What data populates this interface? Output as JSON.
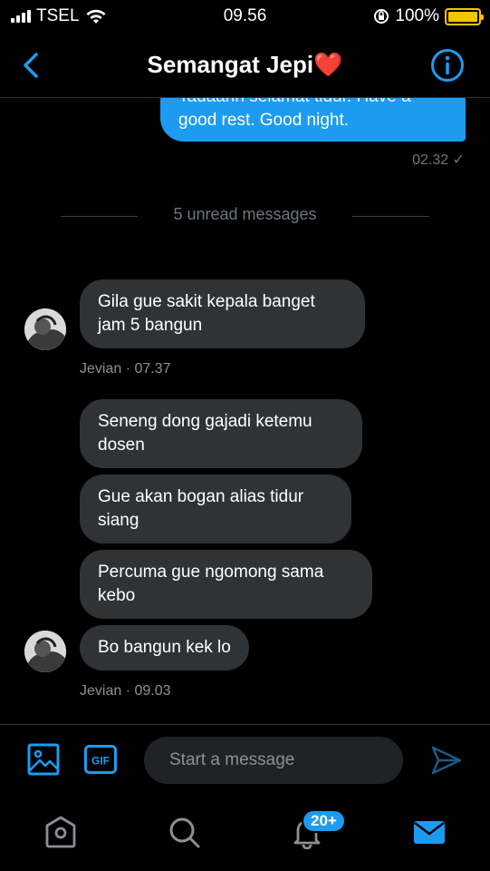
{
  "status_bar": {
    "carrier": "TSEL",
    "time": "09.56",
    "battery": "100%"
  },
  "header": {
    "title": "Semangat Jepi❤️"
  },
  "outgoing": {
    "text_line1": "Tadaahh selamat tidur. Have a",
    "text_line2": "good rest. Good night.",
    "time": "02.32 ✓"
  },
  "divider": {
    "label": "5 unread messages"
  },
  "messages": [
    {
      "text": "Gila gue sakit kepala banget jam 5 bangun"
    },
    {
      "text": "Seneng dong gajadi ketemu dosen"
    },
    {
      "text": "Gue akan bogan alias tidur siang"
    },
    {
      "text": "Percuma gue ngomong sama kebo"
    },
    {
      "text": "Bo bangun kek lo"
    }
  ],
  "meta": [
    {
      "sender": "Jevian",
      "time": "· 07.37"
    },
    {
      "sender": "Jevian",
      "time": "· 09.03"
    }
  ],
  "composer": {
    "placeholder": "Start a message",
    "gif_label": "GIF"
  },
  "tabbar": {
    "notification_badge": "20+"
  },
  "colors": {
    "accent": "#1d9bf0",
    "incoming_bubble": "#2f3336",
    "battery": "#f5c400"
  }
}
